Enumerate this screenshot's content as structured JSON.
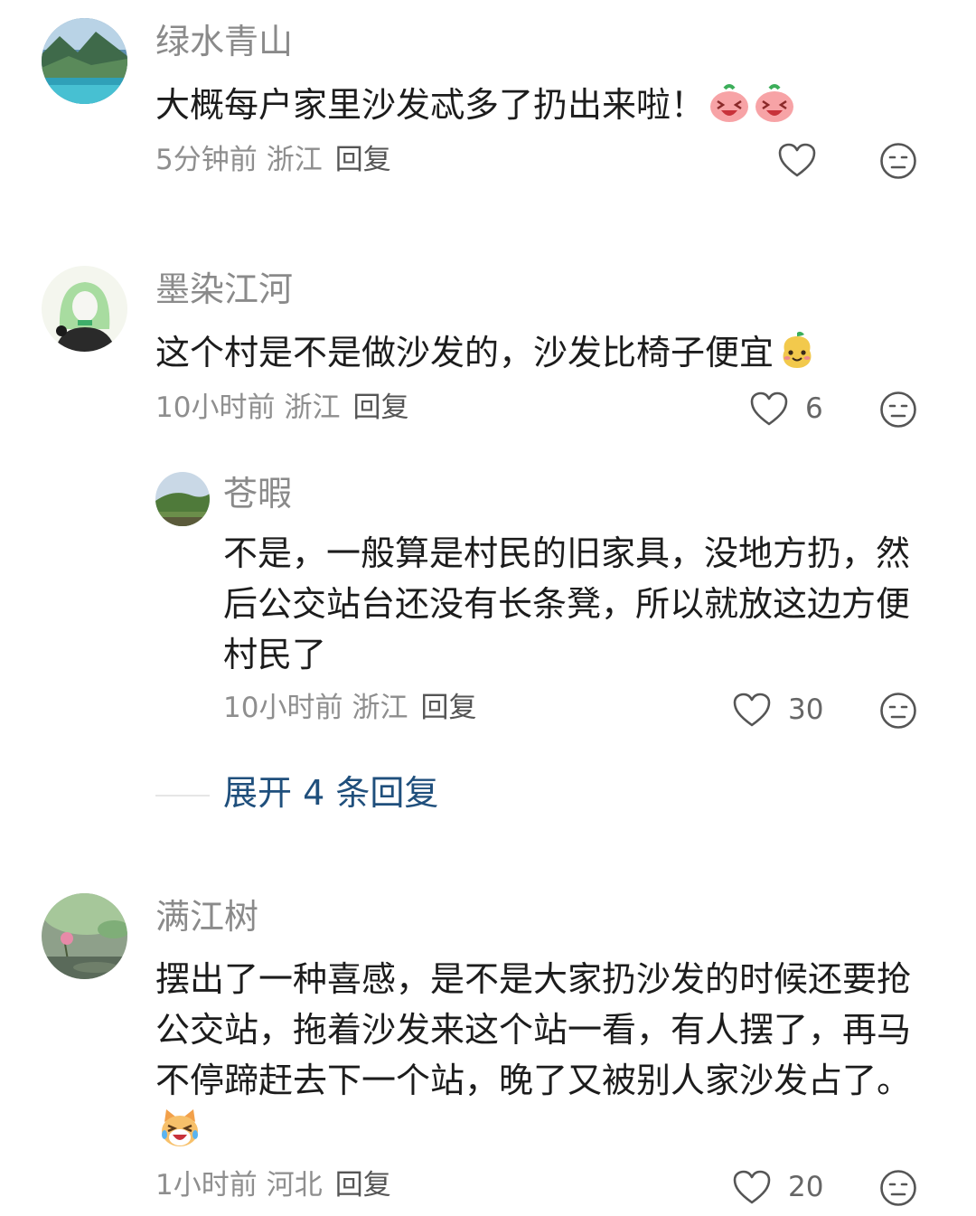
{
  "comments": [
    {
      "user": "绿水青山",
      "text": "大概每户家里沙发忒多了扔出来啦！",
      "time": "5分钟前",
      "location": "浙江",
      "reply_label": "回复",
      "likes": "",
      "emoji": [
        "laughing-peach-icon",
        "laughing-peach-icon"
      ]
    },
    {
      "user": "墨染江河",
      "text": "这个村是不是做沙发的，沙发比椅子便宜",
      "time": "10小时前",
      "location": "浙江",
      "reply_label": "回复",
      "likes": "6",
      "emoji": [
        "smiling-pear-icon"
      ],
      "replies": [
        {
          "user": "苍暇",
          "text": "不是，一般算是村民的旧家具，没地方扔，然后公交站台还没有长条凳，所以就放这边方便村民了",
          "time": "10小时前",
          "location": "浙江",
          "reply_label": "回复",
          "likes": "30"
        }
      ],
      "expand_label": "展开 4 条回复"
    },
    {
      "user": "满江树",
      "text": "摆出了一种喜感，是不是大家扔沙发的时候还要抢公交站，拖着沙发来这个站一看，有人摆了，再马不停蹄赶去下一个站，晚了又被别人家沙发占了。",
      "time": "1小时前",
      "location": "河北",
      "reply_label": "回复",
      "likes": "20",
      "emoji": [
        "laughing-cat-icon"
      ]
    }
  ],
  "icons": {
    "like": "heart-outline-icon",
    "dislike": "neutral-face-icon"
  },
  "colors": {
    "name": "#8a8a8a",
    "text": "#1c1c1c",
    "meta": "#8e8e8e",
    "link": "#1f4f7c"
  }
}
